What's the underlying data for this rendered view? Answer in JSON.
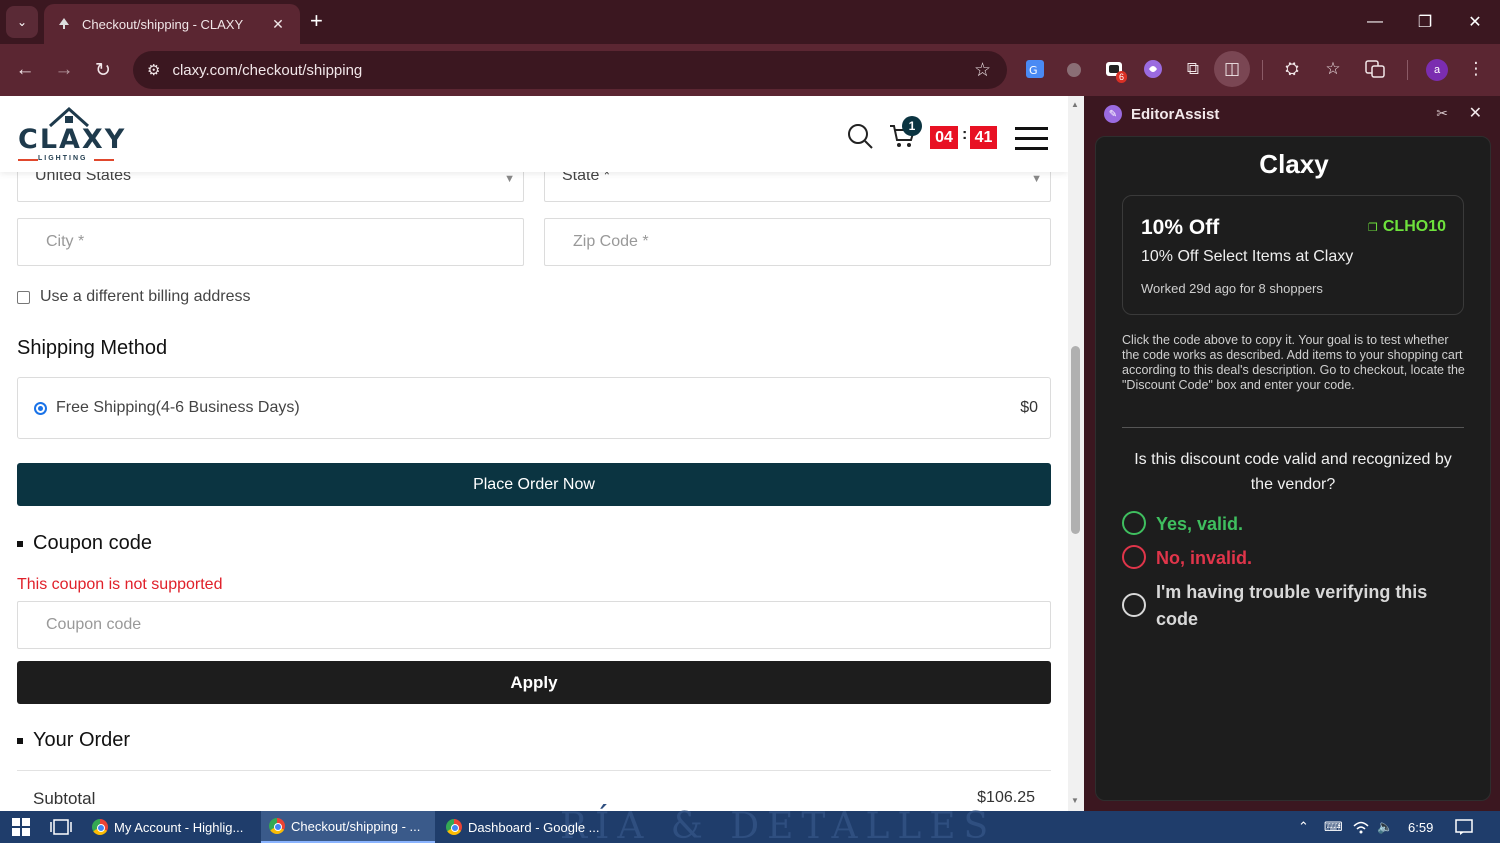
{
  "browser": {
    "tab_title": "Checkout/shipping - CLAXY",
    "url": "claxy.com/checkout/shipping",
    "extension_badge": "6",
    "profile_initial": "a"
  },
  "site": {
    "logo_text": "CLAXY",
    "logo_sub": "LIGHTING",
    "cart_count": "1",
    "timer_minutes": "04",
    "timer_seconds": "41"
  },
  "form": {
    "country_value": "United States",
    "state_placeholder": "State *",
    "city_placeholder": "City *",
    "zip_placeholder": "Zip Code *",
    "billing_checkbox_label": "Use a different billing address"
  },
  "shipping": {
    "section_title": "Shipping Method",
    "option_label": "Free Shipping(4-6 Business Days)",
    "option_price": "$0"
  },
  "place_order_label": "Place Order Now",
  "coupon": {
    "section_title": "Coupon code",
    "error": "This coupon is not supported",
    "placeholder": "Coupon code",
    "apply_label": "Apply"
  },
  "order": {
    "section_title": "Your Order",
    "subtotal_label": "Subtotal",
    "subtotal_value": "$106.25"
  },
  "panel": {
    "name": "EditorAssist",
    "brand": "Claxy",
    "deal_title": "10% Off",
    "deal_code": "CLHO10",
    "deal_description": "10% Off Select Items at Claxy",
    "deal_meta": "Worked 29d ago for 8 shoppers",
    "instructions": "Click the code above to copy it. Your goal is to test whether the code works as described. Add items to your shopping cart according to this deal's description. Go to checkout, locate the \"Discount Code\" box and enter your code.",
    "question": "Is this discount code valid and recognized by the vendor?",
    "option_valid": "Yes, valid.",
    "option_invalid": "No, invalid.",
    "option_trouble": "I'm having trouble verifying this code",
    "colors": {
      "valid": "#3fbf5f",
      "invalid": "#e0354a",
      "neutral": "#d8d8d8"
    }
  },
  "taskbar": {
    "items": [
      "My Account - Highlig...",
      "Checkout/shipping - ...",
      "Dashboard - Google ..."
    ],
    "time": "6:59",
    "background_text": "RÍA & DETALLES"
  }
}
